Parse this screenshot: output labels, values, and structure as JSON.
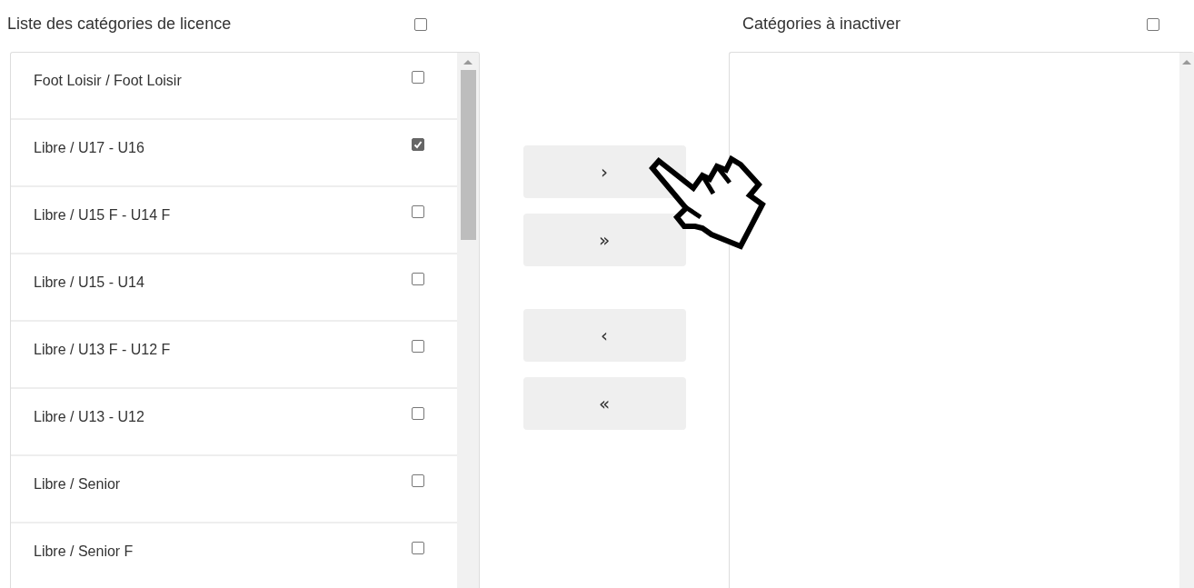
{
  "source_panel": {
    "title": "Liste des catégories de licence",
    "select_all_checked": false,
    "items": [
      {
        "label": "Foot Loisir / Foot Loisir",
        "checked": false
      },
      {
        "label": "Libre / U17 - U16",
        "checked": true
      },
      {
        "label": "Libre / U15 F - U14 F",
        "checked": false
      },
      {
        "label": "Libre / U15 - U14",
        "checked": false
      },
      {
        "label": "Libre / U13 F - U12 F",
        "checked": false
      },
      {
        "label": "Libre / U13 - U12",
        "checked": false
      },
      {
        "label": "Libre / Senior",
        "checked": false
      },
      {
        "label": "Libre / Senior F",
        "checked": false
      }
    ]
  },
  "transfer_buttons": [
    {
      "label": "›",
      "kind": "move-right"
    },
    {
      "label": "»",
      "kind": "move-all-right"
    },
    {
      "label": "‹",
      "kind": "move-left"
    },
    {
      "label": "«",
      "kind": "move-all-left"
    }
  ],
  "target_panel": {
    "title": "Catégories à inactiver",
    "select_all_checked": false
  }
}
